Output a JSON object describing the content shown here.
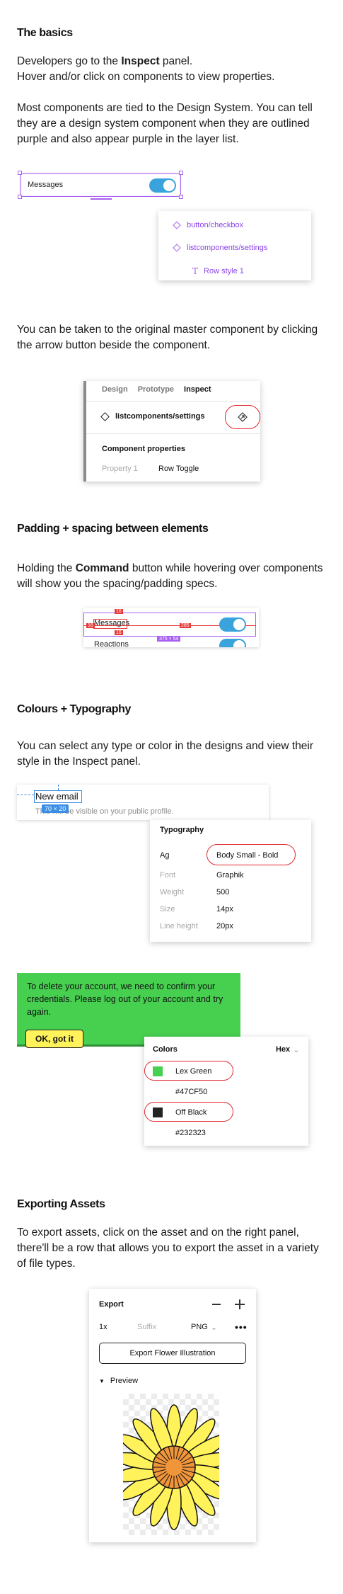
{
  "basics": {
    "heading": "The basics",
    "p1_pre": "Developers go to the ",
    "p1_bold": "Inspect",
    "p1_post": " panel.",
    "p2": "Hover and/or click on components to view properties.",
    "p3": "Most components are tied to the Design System. You can tell they are a design system component when they are outlined purple and also appear purple in the layer list.",
    "demo_row_label": "Messages",
    "layers": [
      "button/checkbox",
      "listcomponents/settings",
      "Row style 1"
    ]
  },
  "master": {
    "text": "You can be taken to the original master component by clicking the arrow button beside the component.",
    "tabs": [
      "Design",
      "Prototype",
      "Inspect"
    ],
    "component_name": "listcomponents/settings",
    "section_title": "Component properties",
    "property_label": "Property 1",
    "property_value": "Row Toggle"
  },
  "padding": {
    "heading": "Padding + spacing between elements",
    "p_pre": "Holding the ",
    "p_bold": "Command",
    "p_post": " button while hovering over components will show you the spacing/padding specs.",
    "row1": "Messages",
    "row2": "Reactions",
    "spec_top": "16",
    "spec_left": "16",
    "spec_inner": "16",
    "spec_right": "285",
    "spec_size": "375 × 54"
  },
  "colours": {
    "heading": "Colours + Typography",
    "text": "You can select any type or color in the designs and view their style in the Inspect panel.",
    "input_value": "New email",
    "helper_text": "This will be visible on your public profile.",
    "size_badge": "70 × 20",
    "typography": {
      "title": "Typography",
      "style_label": "Ag",
      "style_name": "Body Small - Bold",
      "rows": [
        {
          "label": "Font",
          "value": "Graphik"
        },
        {
          "label": "Weight",
          "value": "500"
        },
        {
          "label": "Size",
          "value": "14px"
        },
        {
          "label": "Line height",
          "value": "20px"
        }
      ]
    },
    "alert": {
      "text": "To delete your account, we need to confirm your credentials. Please log out of your account and try again.",
      "button": "OK, got it",
      "bg": "#47CF50",
      "button_bg": "#FFF25A"
    },
    "colors_panel": {
      "title": "Colors",
      "format": "Hex",
      "items": [
        {
          "name": "Lex Green",
          "hex": "#47CF50",
          "swatch": "#47CF50"
        },
        {
          "name": "Off Black",
          "hex": "#232323",
          "swatch": "#232323"
        }
      ]
    }
  },
  "export": {
    "heading": "Exporting Assets",
    "text": "To export assets, click on the asset and on the right panel, there'll be a row that allows you to export the asset in a variety of file types.",
    "panel_title": "Export",
    "scale": "1x",
    "suffix_placeholder": "Suffix",
    "format": "PNG",
    "button": "Export Flower Illustration",
    "preview_label": "Preview",
    "flower_petal": "#FFF25A",
    "flower_center": "#F0953A"
  }
}
